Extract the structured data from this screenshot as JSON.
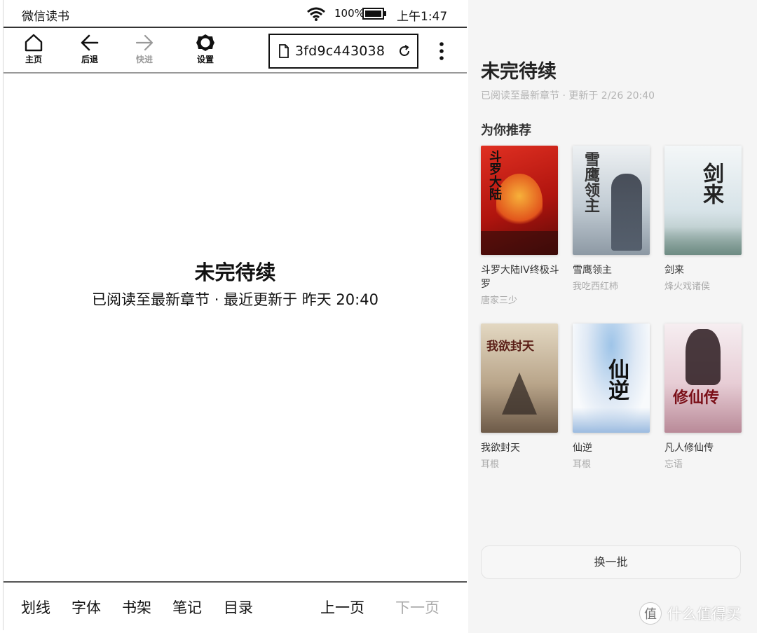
{
  "status_bar": {
    "app_name": "微信读书",
    "battery": "100%",
    "time": "上午1:47"
  },
  "toolbar": {
    "home_label": "主页",
    "back_label": "后退",
    "forward_label": "快进",
    "settings_label": "设置",
    "url": "3fd9c443038",
    "icons": [
      "home-icon",
      "back-arrow-icon",
      "forward-arrow-icon",
      "gear-icon",
      "document-icon",
      "reload-icon",
      "kebab-menu-icon"
    ]
  },
  "reader": {
    "title": "未完待续",
    "subtitle": "已阅读至最新章节 · 最近更新于 昨天 20:40"
  },
  "bottom_bar": {
    "underline": "划线",
    "font": "字体",
    "shelf": "书架",
    "notes": "笔记",
    "toc": "目录",
    "prev": "上一页",
    "next": "下一页"
  },
  "web": {
    "title": "未完待续",
    "subtitle": "已阅读至最新章节 · 更新于 2/26 20:40",
    "recommend_heading": "为你推荐",
    "books": [
      {
        "title": "斗罗大陆IV终极斗罗",
        "author": "唐家三少",
        "cover_text": "斗罗大陆",
        "cover_color": "#d8261c"
      },
      {
        "title": "雪鹰领主",
        "author": "我吃西红柿",
        "cover_text": "雪鹰领主",
        "cover_color": "#c9d3dc"
      },
      {
        "title": "剑来",
        "author": "烽火戏诸侯",
        "cover_text": "剑来",
        "cover_color": "#dfe8ec"
      },
      {
        "title": "我欲封天",
        "author": "耳根",
        "cover_text": "我欲封天",
        "cover_color": "#b9a58a"
      },
      {
        "title": "仙逆",
        "author": "耳根",
        "cover_text": "仙逆",
        "cover_color": "#e9eef5"
      },
      {
        "title": "凡人修仙传",
        "author": "忘语",
        "cover_text": "修仙传",
        "cover_color": "#f0e2e6"
      }
    ],
    "swap_label": "换一批"
  },
  "watermark": {
    "text": "什么值得买",
    "logo_glyph": "值"
  },
  "colors": {
    "accent_text": "#111111",
    "muted_text": "#aaaaaa",
    "panel_bg": "#f5f5f5"
  }
}
